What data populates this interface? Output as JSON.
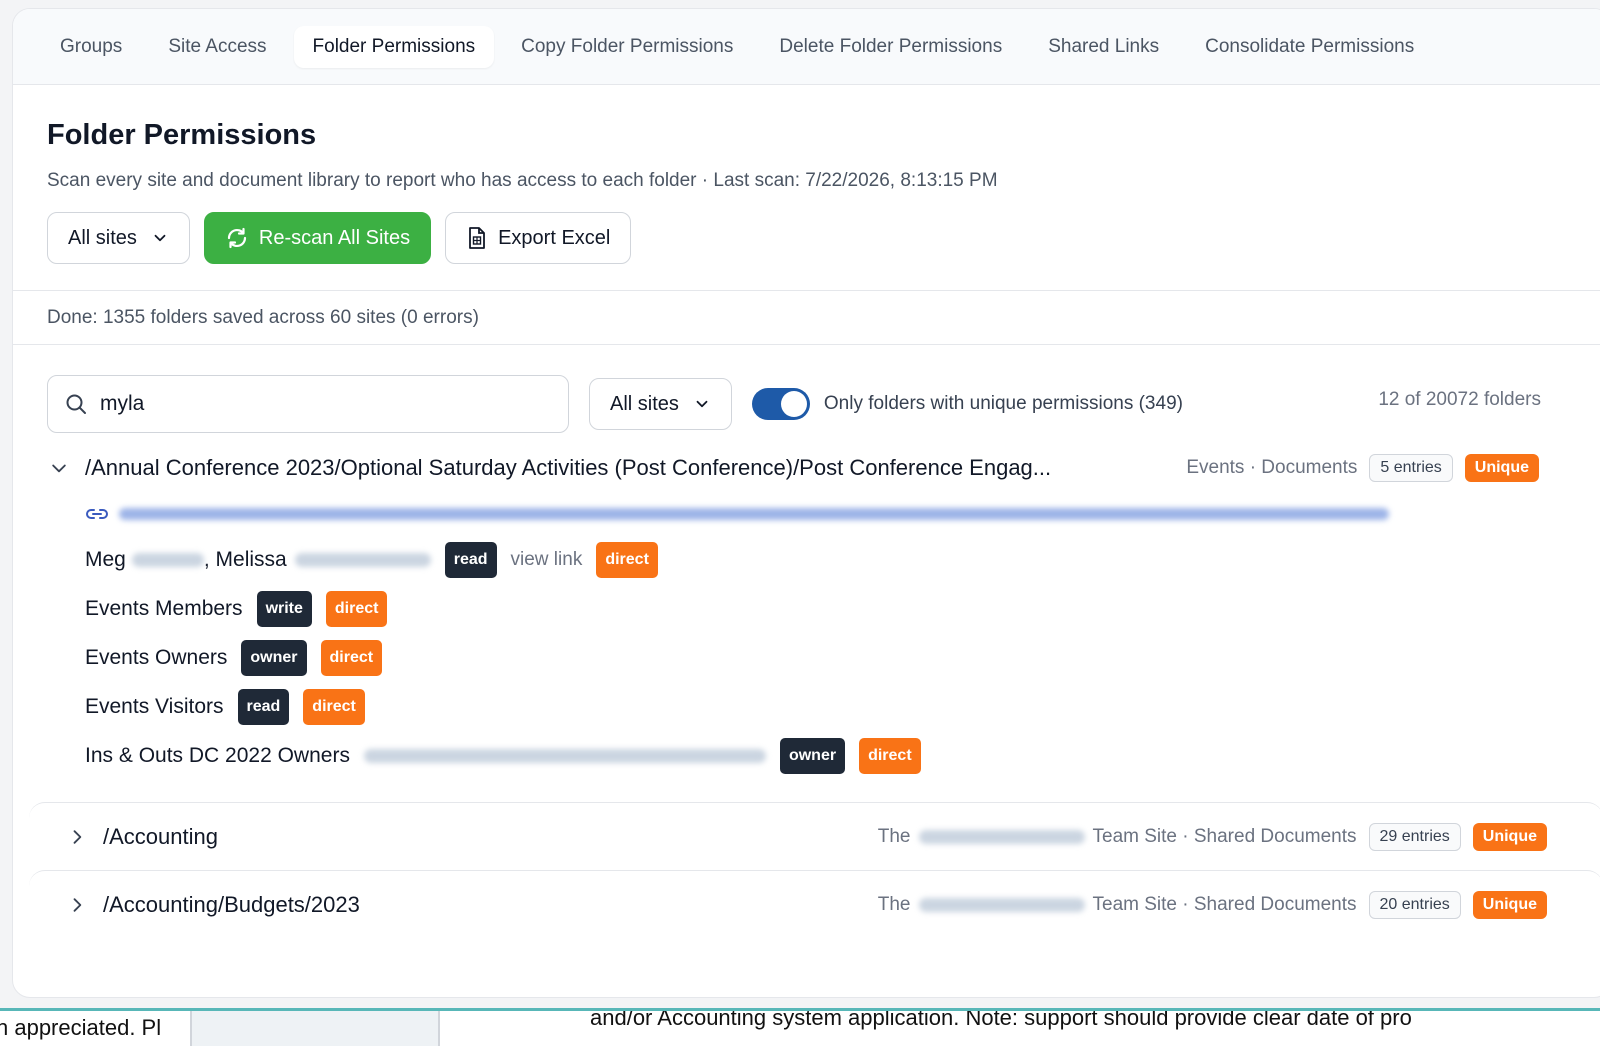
{
  "tabs": [
    "Groups",
    "Site Access",
    "Folder Permissions",
    "Copy Folder Permissions",
    "Delete Folder Permissions",
    "Shared Links",
    "Consolidate Permissions"
  ],
  "header": {
    "title": "Folder Permissions",
    "subtitle": "Scan every site and document library to report who has access to each folder · Last scan: 7/22/2026, 8:13:15 PM",
    "site_select": "All sites",
    "rescan_label": "Re-scan All Sites",
    "export_label": "Export Excel"
  },
  "status": "Done: 1355 folders saved across 60 sites (0 errors)",
  "filters": {
    "search_value": "myla",
    "site_select": "All sites",
    "toggle_label": "Only folders with unique permissions (349)",
    "toggle_on": true,
    "count": "12 of 20072 folders"
  },
  "folders": [
    {
      "path": "/Annual Conference 2023/Optional Saturday Activities (Post Conference)/Post Conference Engag...",
      "site": "Events · Documents",
      "entries": "5 entries",
      "badge": "Unique",
      "expanded": true,
      "permissions": [
        {
          "name_a": "Meg",
          "name_b": ", Melissa",
          "level": "read",
          "extra": "view link",
          "type": "direct"
        },
        {
          "name": "Events Members",
          "level": "write",
          "type": "direct"
        },
        {
          "name": "Events Owners",
          "level": "owner",
          "type": "direct"
        },
        {
          "name": "Events Visitors",
          "level": "read",
          "type": "direct"
        },
        {
          "name": "Ins & Outs DC 2022 Owners",
          "level": "owner",
          "type": "direct"
        }
      ]
    },
    {
      "path": "/Accounting",
      "site_prefix": "The",
      "site_suffix": "Team Site · Shared Documents",
      "entries": "29 entries",
      "badge": "Unique",
      "expanded": false
    },
    {
      "path": "/Accounting/Budgets/2023",
      "site_prefix": "The",
      "site_suffix": "Team Site · Shared Documents",
      "entries": "20 entries",
      "badge": "Unique",
      "expanded": false
    }
  ],
  "background": {
    "left_text": "n appreciated. Pl",
    "right_text": "and/or Accounting system application. Note: support should provide clear date of pro"
  },
  "colors": {
    "primary_green": "#3cb043",
    "unique_orange": "#f97316",
    "toggle_blue": "#1e5aa8",
    "tag_dark": "#1f2937"
  },
  "icons": [
    "chevron-down-icon",
    "refresh-icon",
    "excel-file-icon",
    "search-icon",
    "chevron-right-icon",
    "link-icon"
  ]
}
